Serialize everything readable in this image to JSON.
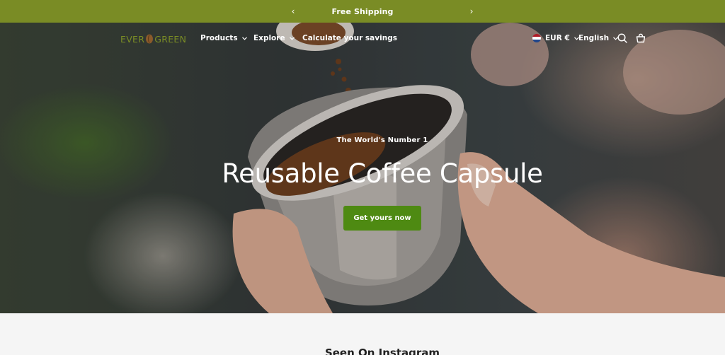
{
  "announcement": {
    "text": "Free Shipping",
    "prev_icon": "chevron-left-icon",
    "next_icon": "chevron-right-icon",
    "background": "#7a8c25"
  },
  "header": {
    "logo_left": "EVER",
    "logo_right": "GREEN",
    "nav": [
      {
        "label": "Products",
        "has_dropdown": true
      },
      {
        "label": "Explore",
        "has_dropdown": true
      },
      {
        "label": "Calculate your savings",
        "has_dropdown": false
      }
    ],
    "currency": "EUR €",
    "language": "English",
    "icons": [
      "flag-nl-icon",
      "search-icon",
      "cart-icon",
      "chevron-down-icon"
    ]
  },
  "hero": {
    "eyebrow": "The World's Number 1",
    "headline": "Reusable Coffee Capsule",
    "cta_label": "Get yours now",
    "cta_color": "#4e8a12"
  },
  "section": {
    "title": "Seen On Instagram"
  }
}
